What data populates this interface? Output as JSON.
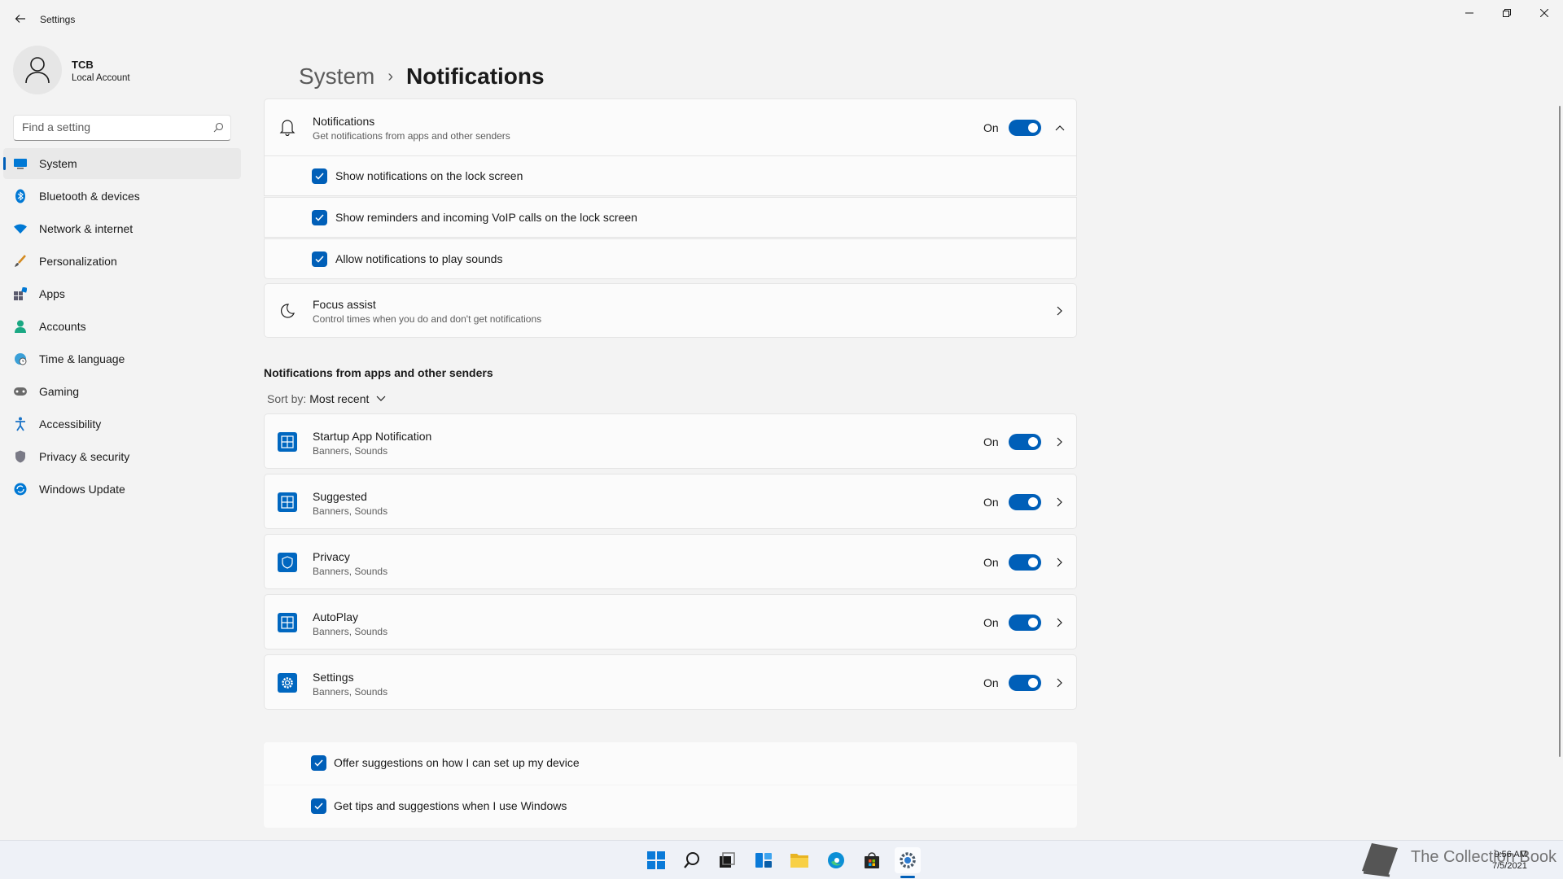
{
  "window": {
    "title": "Settings"
  },
  "profile": {
    "name": "TCB",
    "account_type": "Local Account"
  },
  "search": {
    "placeholder": "Find a setting"
  },
  "sidebar": {
    "items": [
      {
        "label": "System",
        "icon": "system-icon",
        "active": true
      },
      {
        "label": "Bluetooth & devices",
        "icon": "bluetooth-icon"
      },
      {
        "label": "Network & internet",
        "icon": "wifi-icon"
      },
      {
        "label": "Personalization",
        "icon": "brush-icon"
      },
      {
        "label": "Apps",
        "icon": "apps-icon"
      },
      {
        "label": "Accounts",
        "icon": "person-icon"
      },
      {
        "label": "Time & language",
        "icon": "globe-clock-icon"
      },
      {
        "label": "Gaming",
        "icon": "gamepad-icon"
      },
      {
        "label": "Accessibility",
        "icon": "accessibility-icon"
      },
      {
        "label": "Privacy & security",
        "icon": "shield-icon"
      },
      {
        "label": "Windows Update",
        "icon": "update-icon"
      }
    ]
  },
  "breadcrumb": {
    "root": "System",
    "separator": "›",
    "current": "Notifications"
  },
  "notifications": {
    "title": "Notifications",
    "subtitle": "Get notifications from apps and other senders",
    "state": "On",
    "options": [
      {
        "label": "Show notifications on the lock screen",
        "checked": true
      },
      {
        "label": "Show reminders and incoming VoIP calls on the lock screen",
        "checked": true
      },
      {
        "label": "Allow notifications to play sounds",
        "checked": true
      }
    ]
  },
  "focus_assist": {
    "title": "Focus assist",
    "subtitle": "Control times when you do and don't get notifications"
  },
  "apps_section": {
    "title": "Notifications from apps and other senders",
    "sort_label": "Sort by:",
    "sort_value": "Most recent",
    "apps": [
      {
        "name": "Startup App Notification",
        "detail": "Banners, Sounds",
        "state": "On",
        "icon": "startup-app-icon"
      },
      {
        "name": "Suggested",
        "detail": "Banners, Sounds",
        "state": "On",
        "icon": "suggested-app-icon"
      },
      {
        "name": "Privacy",
        "detail": "Banners, Sounds",
        "state": "On",
        "icon": "privacy-app-icon"
      },
      {
        "name": "AutoPlay",
        "detail": "Banners, Sounds",
        "state": "On",
        "icon": "autoplay-app-icon"
      },
      {
        "name": "Settings",
        "detail": "Banners, Sounds",
        "state": "On",
        "icon": "settings-app-icon"
      }
    ]
  },
  "bottom_options": [
    {
      "label": "Offer suggestions on how I can set up my device",
      "checked": true
    },
    {
      "label": "Get tips and suggestions when I use Windows",
      "checked": true
    }
  ],
  "taskbar": {
    "time": "9:56 AM",
    "date": "7/5/2021",
    "watermark": "The Collection Book"
  },
  "colors": {
    "accent": "#005fb8",
    "background": "#f3f3f3",
    "card": "#fbfbfb"
  }
}
